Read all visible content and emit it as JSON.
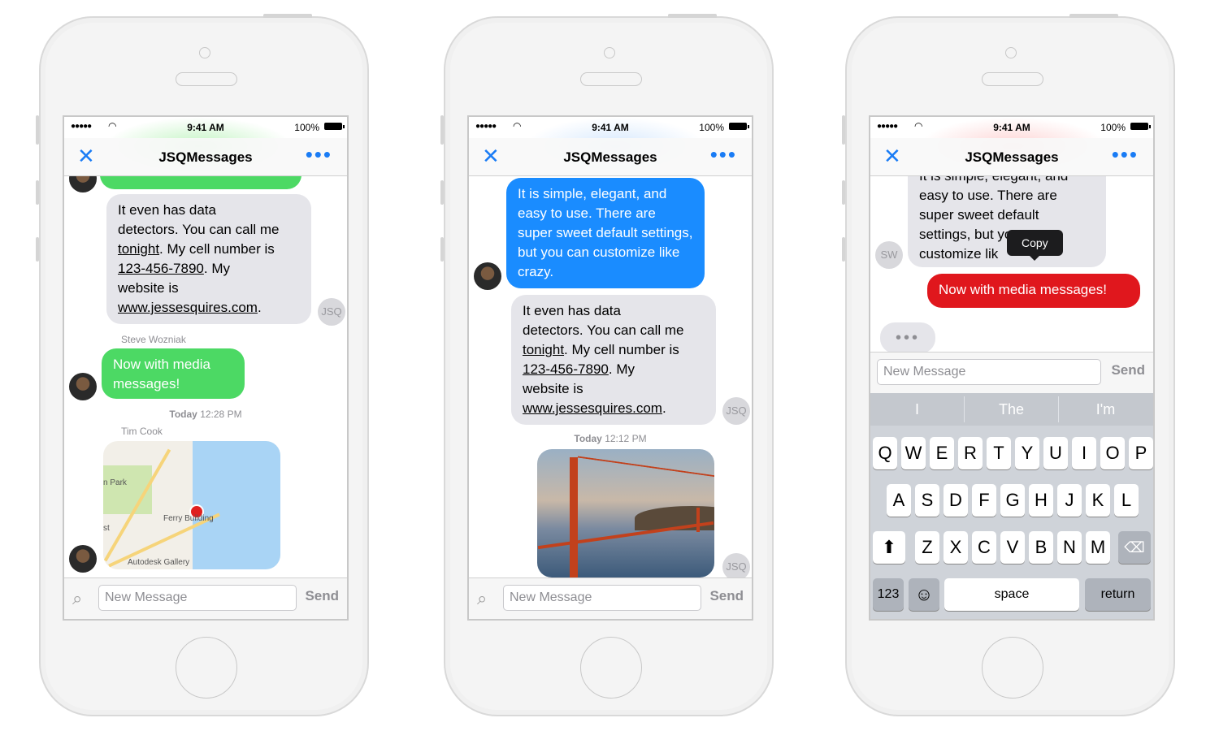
{
  "status": {
    "signal": "●●●●●",
    "time": "9:41 AM",
    "battery": "100%"
  },
  "nav": {
    "title": "JSQMessages",
    "close_icon": "close-icon",
    "more_icon": "more-icon"
  },
  "input": {
    "placeholder": "New Message",
    "send": "Send"
  },
  "phone1": {
    "top_bubble_fragment": "...",
    "data_bubble": {
      "line1": "It even has data",
      "line2": "detectors. You can call me",
      "link_tonight": "tonight",
      "line3_rest": ". My cell number is",
      "link_phone": "123-456-7890",
      "line4_rest": ". My",
      "line5": "website is",
      "link_web": "www.jessesquires.com",
      "line6_rest": "."
    },
    "jsq_avatar": "JSQ",
    "sender_woz": "Steve Wozniak",
    "media_bubble": "Now with media messages!",
    "timestamp_day": "Today",
    "timestamp_time": "12:28 PM",
    "sender_cook": "Tim Cook",
    "map_labels": {
      "park": "n Park",
      "ferry": "Ferry Building",
      "gallery": "Autodesk Gallery",
      "st": "st"
    }
  },
  "phone2": {
    "blue_bubble": "It is simple, elegant, and easy to use. There are super sweet default settings, but you can customize like crazy.",
    "data_bubble": {
      "line1": "It even has data",
      "line2": "detectors. You can call me",
      "link_tonight": "tonight",
      "line3_rest": ". My cell number is",
      "link_phone": "123-456-7890",
      "line4_rest": ". My",
      "line5": "website is",
      "link_web": "www.jessesquires.com",
      "line6_rest": "."
    },
    "jsq_avatar": "JSQ",
    "timestamp_day": "Today",
    "timestamp_time": "12:12 PM"
  },
  "phone3": {
    "gray_bubble_lines": [
      "It is simple, elegant, and",
      "easy to use. There are",
      "super sweet default",
      "settings, but you can",
      "customize lik"
    ],
    "sw_avatar": "SW",
    "copy_tooltip": "Copy",
    "red_bubble": "Now with media messages!",
    "typing": "•••",
    "suggestions": [
      "I",
      "The",
      "I'm"
    ],
    "row1": [
      "Q",
      "W",
      "E",
      "R",
      "T",
      "Y",
      "U",
      "I",
      "O",
      "P"
    ],
    "row2": [
      "A",
      "S",
      "D",
      "F",
      "G",
      "H",
      "J",
      "K",
      "L"
    ],
    "row3": [
      "Z",
      "X",
      "C",
      "V",
      "B",
      "N",
      "M"
    ],
    "key_123": "123",
    "key_space": "space",
    "key_return": "return",
    "shift_icon": "⬆",
    "delete_icon": "⌫",
    "emoji_icon": "☺"
  },
  "colors": {
    "ios_blue": "#1a7cf5",
    "green_bubble": "#4cd964",
    "blue_bubble": "#1a8cff",
    "red_bubble": "#e0171d",
    "gray_bubble": "#e5e5ea"
  }
}
